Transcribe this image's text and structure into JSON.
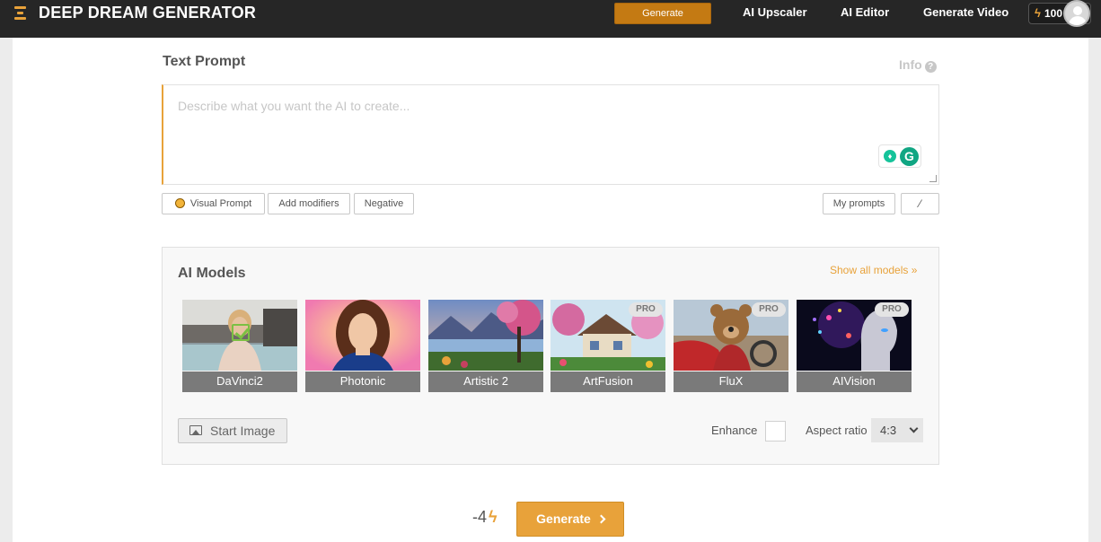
{
  "header": {
    "logo_text": "DEEP DREAM GENERATOR",
    "generate_label": "Generate",
    "nav": [
      "AI Upscaler",
      "AI Editor",
      "Generate Video"
    ],
    "credits": "100",
    "accent_color": "#e8a23a"
  },
  "prompt": {
    "title": "Text Prompt",
    "info_label": "Info",
    "value": "",
    "placeholder": "Describe what you want the AI to create...",
    "buttons": {
      "visual_prompt": "Visual Prompt",
      "add_modifiers": "Add modifiers",
      "negative": "Negative",
      "my_prompts": "My prompts"
    }
  },
  "models": {
    "title": "AI Models",
    "show_all": "Show all models",
    "items": [
      {
        "name": "DaVinci2",
        "pro": false,
        "selected": true
      },
      {
        "name": "Photonic",
        "pro": false,
        "selected": false
      },
      {
        "name": "Artistic 2",
        "pro": false,
        "selected": false
      },
      {
        "name": "ArtFusion",
        "pro": true,
        "selected": false
      },
      {
        "name": "FluX",
        "pro": true,
        "selected": false
      },
      {
        "name": "AIVision",
        "pro": true,
        "selected": false
      }
    ],
    "pro_badge": "PRO",
    "start_image": "Start Image",
    "enhance_label": "Enhance",
    "enhance_checked": false,
    "aspect_label": "Aspect ratio",
    "aspect_value": "4:3"
  },
  "generate": {
    "cost": "-4",
    "label": "Generate"
  }
}
